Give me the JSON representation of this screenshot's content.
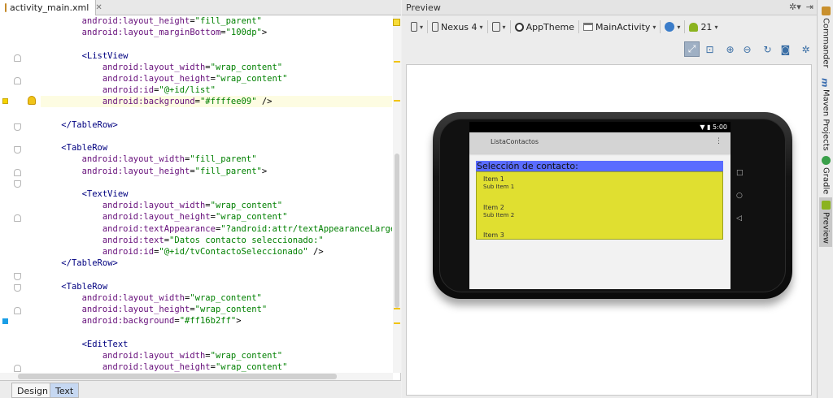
{
  "editor": {
    "file_tab": "activity_main.xml",
    "lines": [
      {
        "indent": "        ",
        "tag": "",
        "attr": "android:layout_height",
        "value": "\"fill_parent\"",
        "tail": ""
      },
      {
        "indent": "        ",
        "tag": "",
        "attr": "android:layout_marginBottom",
        "value": "\"100dp\"",
        "tail": ">"
      },
      {
        "indent": "",
        "tag": "",
        "attr": "",
        "value": "",
        "tail": ""
      },
      {
        "indent": "        ",
        "tag": "<ListView",
        "attr": "",
        "value": "",
        "tail": ""
      },
      {
        "indent": "            ",
        "tag": "",
        "attr": "android:layout_width",
        "value": "\"wrap_content\"",
        "tail": ""
      },
      {
        "indent": "            ",
        "tag": "",
        "attr": "android:layout_height",
        "value": "\"wrap_content\"",
        "tail": ""
      },
      {
        "indent": "            ",
        "tag": "",
        "attr": "android:id",
        "value": "\"@+id/list\"",
        "tail": ""
      },
      {
        "indent": "            ",
        "tag": "",
        "attr": "android:background",
        "value": "\"#ffffee09\"",
        "tail": " />"
      },
      {
        "indent": "",
        "tag": "",
        "attr": "",
        "value": "",
        "tail": ""
      },
      {
        "indent": "    ",
        "tag": "</TableRow>",
        "attr": "",
        "value": "",
        "tail": ""
      },
      {
        "indent": "",
        "tag": "",
        "attr": "",
        "value": "",
        "tail": ""
      },
      {
        "indent": "    ",
        "tag": "<TableRow",
        "attr": "",
        "value": "",
        "tail": ""
      },
      {
        "indent": "        ",
        "tag": "",
        "attr": "android:layout_width",
        "value": "\"fill_parent\"",
        "tail": ""
      },
      {
        "indent": "        ",
        "tag": "",
        "attr": "android:layout_height",
        "value": "\"fill_parent\"",
        "tail": ">"
      },
      {
        "indent": "",
        "tag": "",
        "attr": "",
        "value": "",
        "tail": ""
      },
      {
        "indent": "        ",
        "tag": "<TextView",
        "attr": "",
        "value": "",
        "tail": ""
      },
      {
        "indent": "            ",
        "tag": "",
        "attr": "android:layout_width",
        "value": "\"wrap_content\"",
        "tail": ""
      },
      {
        "indent": "            ",
        "tag": "",
        "attr": "android:layout_height",
        "value": "\"wrap_content\"",
        "tail": ""
      },
      {
        "indent": "            ",
        "tag": "",
        "attr": "android:textAppearance",
        "value": "\"?android:attr/textAppearanceLarge\"",
        "tail": ""
      },
      {
        "indent": "            ",
        "tag": "",
        "attr": "android:text",
        "value": "\"Datos contacto seleccionado:\"",
        "tail": ""
      },
      {
        "indent": "            ",
        "tag": "",
        "attr": "android:id",
        "value": "\"@+id/tvContactoSeleccionado\"",
        "tail": " />"
      },
      {
        "indent": "    ",
        "tag": "</TableRow>",
        "attr": "",
        "value": "",
        "tail": ""
      },
      {
        "indent": "",
        "tag": "",
        "attr": "",
        "value": "",
        "tail": ""
      },
      {
        "indent": "    ",
        "tag": "<TableRow",
        "attr": "",
        "value": "",
        "tail": ""
      },
      {
        "indent": "        ",
        "tag": "",
        "attr": "android:layout_width",
        "value": "\"wrap_content\"",
        "tail": ""
      },
      {
        "indent": "        ",
        "tag": "",
        "attr": "android:layout_height",
        "value": "\"wrap_content\"",
        "tail": ""
      },
      {
        "indent": "        ",
        "tag": "",
        "attr": "android:background",
        "value": "\"#ff16b2ff\"",
        "tail": ">"
      },
      {
        "indent": "",
        "tag": "",
        "attr": "",
        "value": "",
        "tail": ""
      },
      {
        "indent": "        ",
        "tag": "<EditText",
        "attr": "",
        "value": "",
        "tail": ""
      },
      {
        "indent": "            ",
        "tag": "",
        "attr": "android:layout_width",
        "value": "\"wrap_content\"",
        "tail": ""
      },
      {
        "indent": "            ",
        "tag": "",
        "attr": "android:layout_height",
        "value": "\"wrap_content\"",
        "tail": ""
      }
    ],
    "bottom_tabs": {
      "design": "Design",
      "text": "Text"
    }
  },
  "preview": {
    "title": "Preview",
    "toolbar": {
      "device": "Nexus 4",
      "theme": "AppTheme",
      "activity": "MainActivity",
      "api_level": "21"
    },
    "phone": {
      "time": "5:00",
      "app_title": "ListaContactos",
      "selection_label": "Selección de contacto:",
      "list_items": [
        {
          "title": "Item 1",
          "subtitle": "Sub Item 1"
        },
        {
          "title": "Item 2",
          "subtitle": "Sub Item 2"
        },
        {
          "title": "Item 3",
          "subtitle": ""
        }
      ]
    }
  },
  "right_strip": {
    "commander": "Commander",
    "maven": "Maven Projects",
    "gradle": "Gradle",
    "preview": "Preview"
  },
  "colors": {
    "list_background": "#e0df30",
    "label_background": "#5a6cff",
    "xml_tag": "#000080",
    "xml_attr": "#660e7a",
    "xml_value": "#008000"
  }
}
